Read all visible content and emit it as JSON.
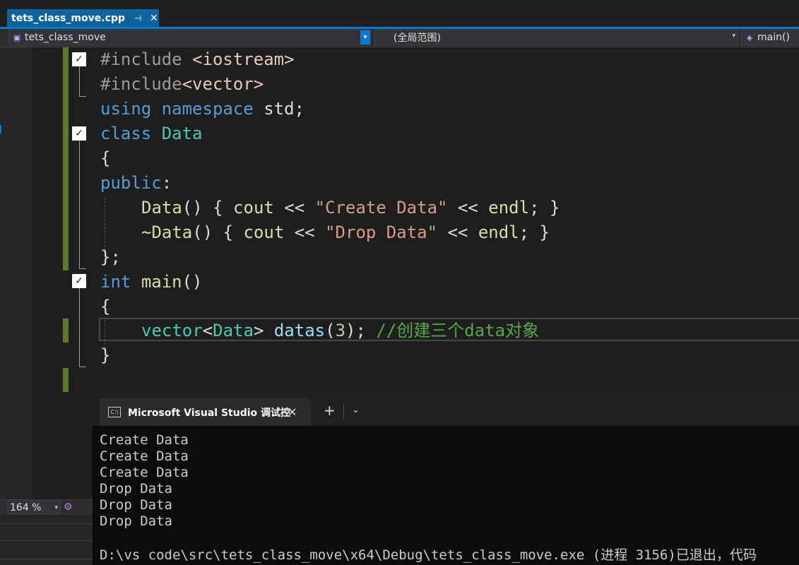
{
  "tab": {
    "filename": "tets_class_move.cpp",
    "pin_icon": "pin-icon",
    "close_icon": "close-icon"
  },
  "navbar": {
    "project": "tets_class_move",
    "scope": "(全局范围)",
    "member": "main()"
  },
  "code": {
    "line1": {
      "kw": "#include",
      "sp": " ",
      "lib": "<iostream>"
    },
    "line2": {
      "kw": "#include",
      "lib": "<vector>"
    },
    "line3": {
      "kw1": "using",
      "kw2": "namespace",
      "rest": " std;"
    },
    "line4": {
      "kw": "class",
      "name": "Data"
    },
    "line5": "{",
    "line6": {
      "kw": "public",
      "colon": ":"
    },
    "line7": {
      "fn": "Data",
      "a": "() { ",
      "id1": "cout",
      "a2": " << ",
      "str": "\"Create Data\"",
      "a3": " << ",
      "id2": "endl",
      "a4": "; }"
    },
    "line8": {
      "fn": "~Data",
      "a": "() { ",
      "id1": "cout",
      "a2": " << ",
      "str": "\"Drop Data\"",
      "a3": " << ",
      "id2": "endl",
      "a4": "; }"
    },
    "line9": "};",
    "line10": {
      "kw": "int",
      "fn": "main",
      "rest": "()"
    },
    "line11": "{",
    "line12": {
      "type": "vector",
      "lt": "<",
      "arg": "Data",
      "gt": "> ",
      "var": "datas",
      "p1": "(",
      "num": "3",
      "p2": "); ",
      "comment": "//创建三个data对象"
    },
    "line13": "}"
  },
  "zoom": {
    "level": "164 %"
  },
  "terminal": {
    "tab_title": "Microsoft Visual Studio 调试控",
    "tab_icon_text": "C:\\",
    "new_tab": "+",
    "output": [
      "Create Data",
      "Create Data",
      "Create Data",
      "Drop Data",
      "Drop Data",
      "Drop Data"
    ],
    "exit_message": "D:\\vs code\\src\\tets_class_move\\x64\\Debug\\tets_class_move.exe (进程 3156)已退出，代码"
  },
  "colors": {
    "keyword": "#569cd6",
    "type": "#4ec9b0",
    "string": "#d69d85",
    "preproc": "#9b9b9b",
    "function": "#dcdcaa",
    "comment": "#57a64a",
    "number": "#b5cea8",
    "include_lib": "#e8c9bb"
  }
}
